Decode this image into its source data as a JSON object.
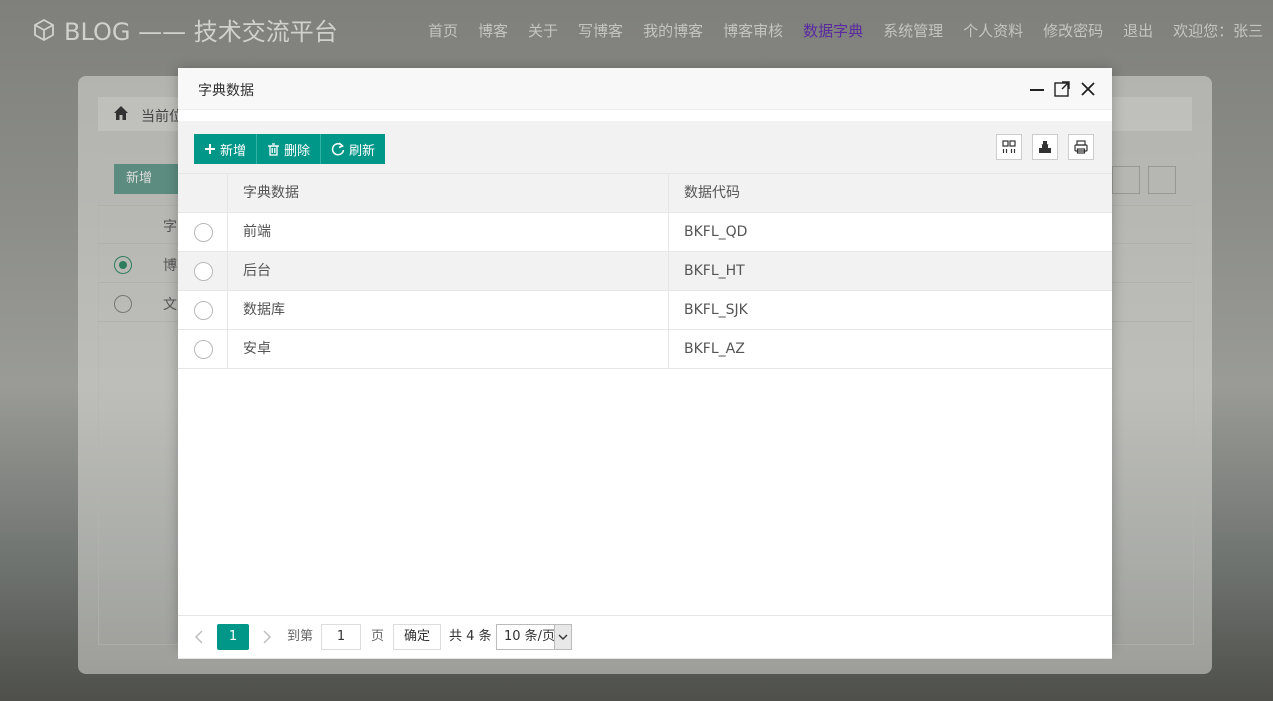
{
  "app": {
    "brand": "BLOG —— 技术交流平台",
    "nav": [
      {
        "label": "首页",
        "active": false
      },
      {
        "label": "博客",
        "active": false
      },
      {
        "label": "关于",
        "active": false
      },
      {
        "label": "写博客",
        "active": false
      },
      {
        "label": "我的博客",
        "active": false
      },
      {
        "label": "博客审核",
        "active": false
      },
      {
        "label": "数据字典",
        "active": true
      },
      {
        "label": "系统管理",
        "active": false
      },
      {
        "label": "个人资料",
        "active": false
      },
      {
        "label": "修改密码",
        "active": false
      },
      {
        "label": "退出",
        "active": false
      },
      {
        "label": "欢迎您：张三",
        "active": false
      }
    ],
    "active_nav_color": "#5a2a9e"
  },
  "background": {
    "breadcrumb": "当前位",
    "add_label": "新增",
    "column_first_char": "字",
    "rows_first_char": [
      "博",
      "文"
    ]
  },
  "modal": {
    "title": "字典数据",
    "toolbar": {
      "add_label": "新增",
      "delete_label": "删除",
      "refresh_label": "刷新"
    },
    "columns": [
      "字典数据",
      "数据代码"
    ],
    "rows": [
      {
        "name": "前端",
        "code": "BKFL_QD"
      },
      {
        "name": "后台",
        "code": "BKFL_HT"
      },
      {
        "name": "数据库",
        "code": "BKFL_SJK"
      },
      {
        "name": "安卓",
        "code": "BKFL_AZ"
      }
    ],
    "pager": {
      "current_page": "1",
      "goto_label": "到第",
      "goto_value": "1",
      "page_unit": "页",
      "confirm_label": "确定",
      "total_text": "共 4 条",
      "page_size": "10 条/页"
    },
    "accent_color": "#009688"
  }
}
